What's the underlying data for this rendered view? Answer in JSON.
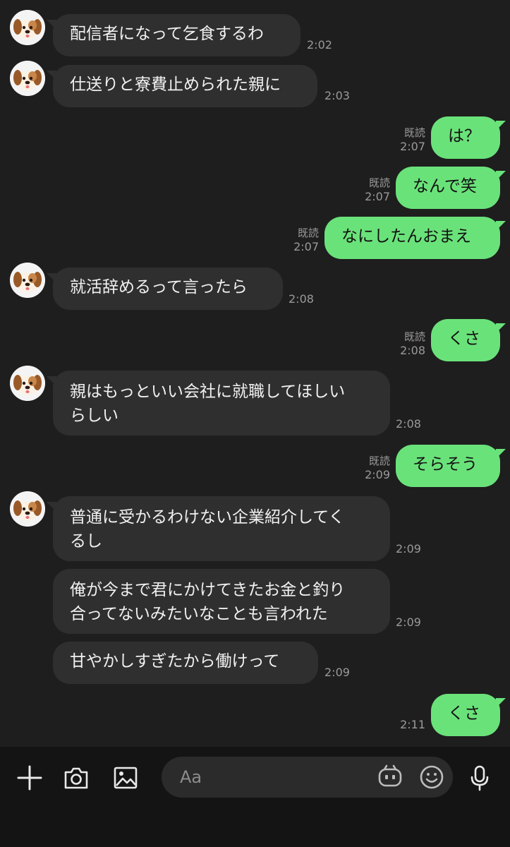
{
  "colors": {
    "background": "#1e1e1e",
    "incoming_bubble": "#2f2f2f",
    "outgoing_bubble": "#6ae27a",
    "meta_text": "#9a9a9a",
    "input_bar": "#141414"
  },
  "messages": [
    {
      "text": "配信者になって乞食するわ",
      "time": "2:02"
    },
    {
      "text": "仕送りと寮費止められた親に",
      "time": "2:03"
    },
    {
      "text": "は？",
      "read": "既読",
      "time": "2:07"
    },
    {
      "text": "なんで笑",
      "read": "既読",
      "time": "2:07"
    },
    {
      "text": "なにしたんおまえ",
      "read": "既読",
      "time": "2:07"
    },
    {
      "text": "就活辞めるって言ったら",
      "time": "2:08"
    },
    {
      "text": "くさ",
      "read": "既読",
      "time": "2:08"
    },
    {
      "text": "親はもっといい会社に就職してほしい\nらしい",
      "time": "2:08"
    },
    {
      "text": "そらそう",
      "read": "既読",
      "time": "2:09"
    },
    {
      "text": "普通に受かるわけない企業紹介してく\nるし",
      "time": "2:09"
    },
    {
      "text": "俺が今まで君にかけてきたお金と釣り\n合ってないみたいなことも言われた",
      "time": "2:09"
    },
    {
      "text": "甘やかしすぎたから働けって",
      "time": "2:09"
    },
    {
      "text": "くさ",
      "time": "2:11"
    }
  ],
  "input": {
    "placeholder": "Aa"
  },
  "icons": {
    "add": "plus-icon",
    "camera": "camera-icon",
    "image": "image-icon",
    "sticker": "sticker-icon",
    "emoji": "emoji-icon",
    "mic": "microphone-icon"
  }
}
